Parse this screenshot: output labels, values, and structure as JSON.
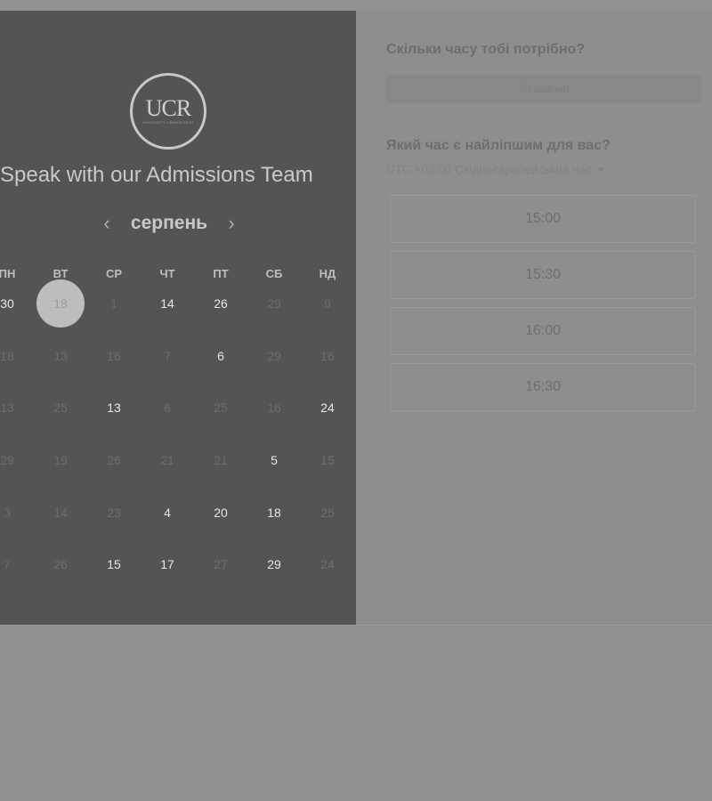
{
  "logo": {
    "text": "UCR",
    "subtext": "UNIVERSITY CANADA WEST"
  },
  "heading": "Speak with our Admissions Team",
  "calendar": {
    "month": "серпень",
    "prev_icon": "chevron-left-icon",
    "next_icon": "chevron-right-icon",
    "weekdays": [
      "ПН",
      "ВТ",
      "СР",
      "ЧТ",
      "ПТ",
      "СБ",
      "НД"
    ],
    "weeks": [
      [
        {
          "d": "30",
          "a": true
        },
        {
          "d": "18",
          "a": false,
          "sel": true
        },
        {
          "d": "1",
          "a": false
        },
        {
          "d": "14",
          "a": true
        },
        {
          "d": "26",
          "a": true
        },
        {
          "d": "29",
          "a": false
        },
        {
          "d": "9",
          "a": false
        }
      ],
      [
        {
          "d": "18",
          "a": false
        },
        {
          "d": "13",
          "a": false
        },
        {
          "d": "16",
          "a": false
        },
        {
          "d": "7",
          "a": false
        },
        {
          "d": "6",
          "a": true
        },
        {
          "d": "29",
          "a": false
        },
        {
          "d": "16",
          "a": false
        }
      ],
      [
        {
          "d": "13",
          "a": false
        },
        {
          "d": "25",
          "a": false
        },
        {
          "d": "13",
          "a": true
        },
        {
          "d": "6",
          "a": false
        },
        {
          "d": "25",
          "a": false
        },
        {
          "d": "16",
          "a": false
        },
        {
          "d": "24",
          "a": true
        }
      ],
      [
        {
          "d": "29",
          "a": false
        },
        {
          "d": "19",
          "a": false
        },
        {
          "d": "26",
          "a": false
        },
        {
          "d": "21",
          "a": false
        },
        {
          "d": "21",
          "a": false
        },
        {
          "d": "5",
          "a": true
        },
        {
          "d": "15",
          "a": false
        }
      ],
      [
        {
          "d": "3",
          "a": false
        },
        {
          "d": "14",
          "a": false
        },
        {
          "d": "23",
          "a": false
        },
        {
          "d": "4",
          "a": true
        },
        {
          "d": "20",
          "a": true
        },
        {
          "d": "18",
          "a": true
        },
        {
          "d": "25",
          "a": false
        }
      ],
      [
        {
          "d": "7",
          "a": false
        },
        {
          "d": "26",
          "a": false
        },
        {
          "d": "15",
          "a": true
        },
        {
          "d": "17",
          "a": true
        },
        {
          "d": "27",
          "a": false
        },
        {
          "d": "29",
          "a": true
        },
        {
          "d": "24",
          "a": false
        }
      ]
    ]
  },
  "duration": {
    "label": "Скільки часу тобі потрібно?",
    "value": "30 хвилин"
  },
  "time": {
    "label": "Який час є найліпшим для вас?",
    "timezone": "UTC +03:00 Східноєвропейський час",
    "slots": [
      "15:00",
      "15:30",
      "16:00",
      "16:30"
    ]
  }
}
